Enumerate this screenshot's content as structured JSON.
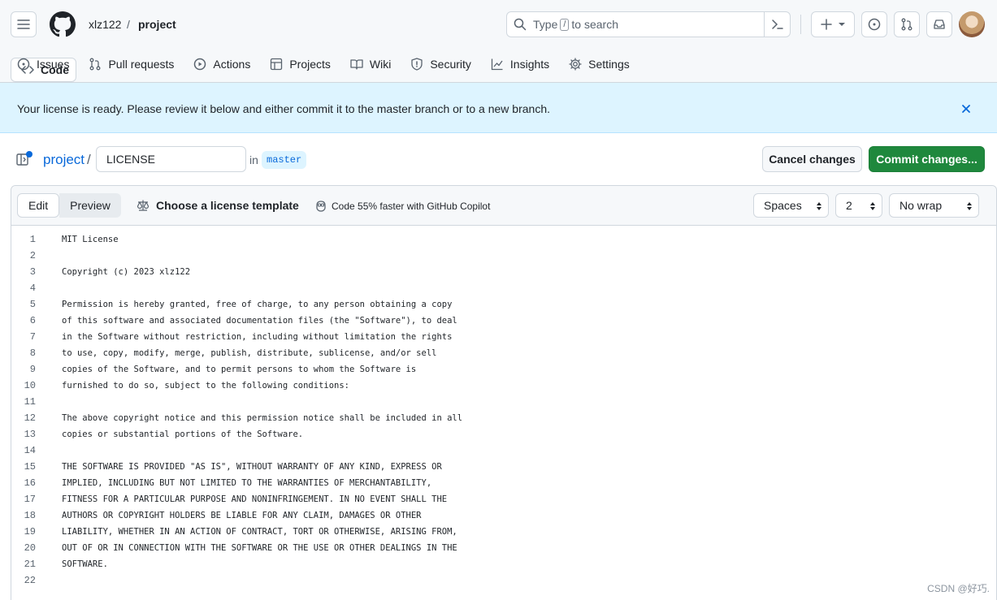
{
  "header": {
    "owner": "xlz122",
    "separator": "/",
    "repo": "project",
    "search_prefix": "Type",
    "search_key": "/",
    "search_suffix": "to search"
  },
  "tabs": [
    {
      "label": "Code",
      "icon": "code-icon",
      "selected": true
    },
    {
      "label": "Issues",
      "icon": "issue-icon"
    },
    {
      "label": "Pull requests",
      "icon": "pull-request-icon"
    },
    {
      "label": "Actions",
      "icon": "play-icon"
    },
    {
      "label": "Projects",
      "icon": "table-icon"
    },
    {
      "label": "Wiki",
      "icon": "book-icon"
    },
    {
      "label": "Security",
      "icon": "shield-icon"
    },
    {
      "label": "Insights",
      "icon": "graph-icon"
    },
    {
      "label": "Settings",
      "icon": "gear-icon"
    }
  ],
  "flash": {
    "message": "Your license is ready. Please review it below and either commit it to the master branch or to a new branch."
  },
  "file": {
    "repo_link": "project",
    "slash": "/",
    "filename": "LICENSE",
    "in_label": "in",
    "branch": "master",
    "cancel_label": "Cancel changes",
    "commit_label": "Commit changes..."
  },
  "editor": {
    "edit_tab": "Edit",
    "preview_tab": "Preview",
    "template_label": "Choose a license template",
    "copilot_label": "Code 55% faster with GitHub Copilot",
    "indent_mode": "Spaces",
    "indent_size": "2",
    "wrap_mode": "No wrap",
    "lines": [
      "MIT License",
      "",
      "Copyright (c) 2023 xlz122",
      "",
      "Permission is hereby granted, free of charge, to any person obtaining a copy",
      "of this software and associated documentation files (the \"Software\"), to deal",
      "in the Software without restriction, including without limitation the rights",
      "to use, copy, modify, merge, publish, distribute, sublicense, and/or sell",
      "copies of the Software, and to permit persons to whom the Software is",
      "furnished to do so, subject to the following conditions:",
      "",
      "The above copyright notice and this permission notice shall be included in all",
      "copies or substantial portions of the Software.",
      "",
      "THE SOFTWARE IS PROVIDED \"AS IS\", WITHOUT WARRANTY OF ANY KIND, EXPRESS OR",
      "IMPLIED, INCLUDING BUT NOT LIMITED TO THE WARRANTIES OF MERCHANTABILITY,",
      "FITNESS FOR A PARTICULAR PURPOSE AND NONINFRINGEMENT. IN NO EVENT SHALL THE",
      "AUTHORS OR COPYRIGHT HOLDERS BE LIABLE FOR ANY CLAIM, DAMAGES OR OTHER",
      "LIABILITY, WHETHER IN AN ACTION OF CONTRACT, TORT OR OTHERWISE, ARISING FROM,",
      "OUT OF OR IN CONNECTION WITH THE SOFTWARE OR THE USE OR OTHER DEALINGS IN THE",
      "SOFTWARE.",
      ""
    ]
  },
  "watermark": "CSDN @好巧.",
  "colors": {
    "accent": "#0969da",
    "commit": "#1f883d",
    "flash_bg": "#ddf4ff",
    "tab_underline": "#fd8c73"
  }
}
